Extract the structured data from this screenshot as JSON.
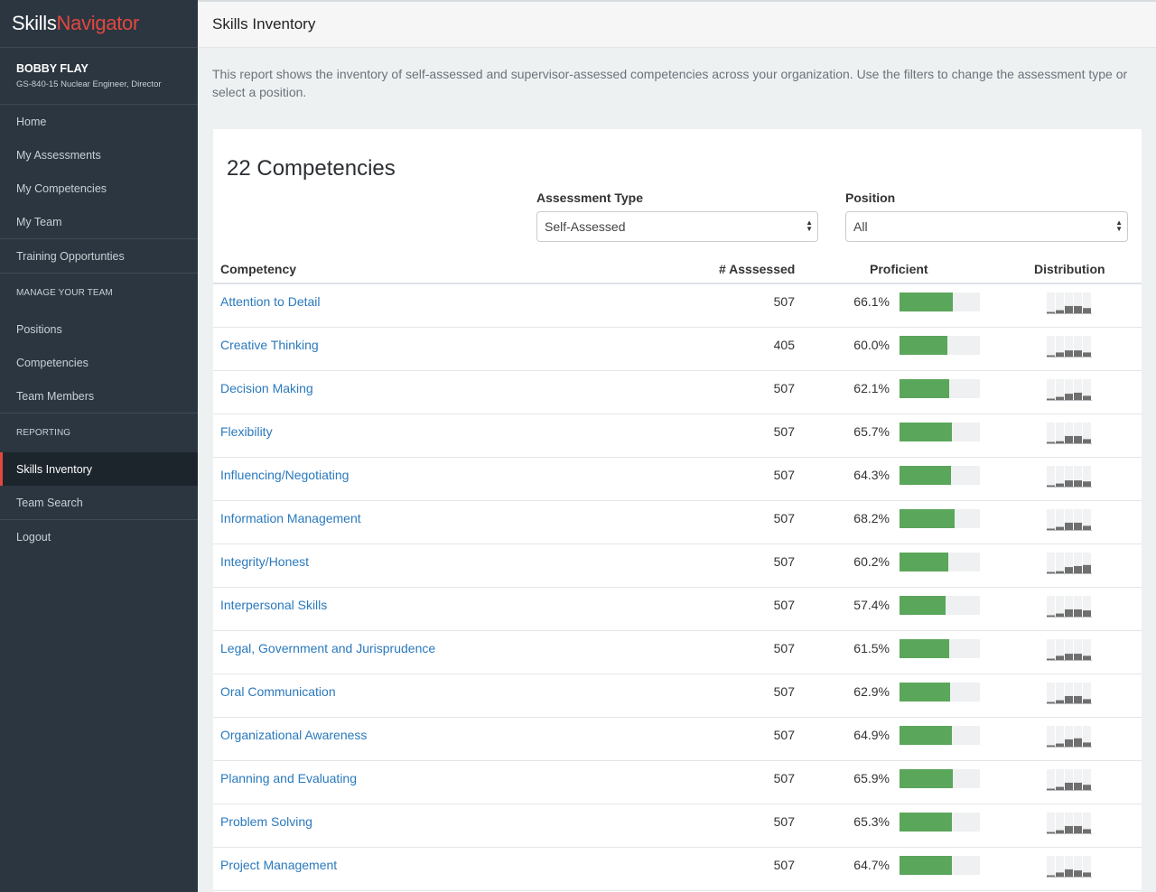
{
  "brand": {
    "part1": "Skills",
    "part2": "Navigator"
  },
  "user": {
    "name": "BOBBY FLAY",
    "title": "GS-840-15 Nuclear Engineer, Director"
  },
  "nav": {
    "home": "Home",
    "my_assessments": "My Assessments",
    "my_competencies": "My Competencies",
    "my_team": "My Team",
    "training": "Training Opportunties",
    "manage_header": "MANAGE YOUR TEAM",
    "positions": "Positions",
    "competencies": "Competencies",
    "team_members": "Team Members",
    "reporting_header": "REPORTING",
    "skills_inventory": "Skills Inventory",
    "team_search": "Team Search",
    "logout": "Logout"
  },
  "page": {
    "title": "Skills Inventory",
    "description": "This report shows the inventory of self-assessed and supervisor-assessed competencies across your organization. Use the filters to change the assessment type or select a position."
  },
  "panel": {
    "count_label": "22 Competencies",
    "assessment_type_label": "Assessment Type",
    "assessment_type_value": "Self-Assessed",
    "position_label": "Position",
    "position_value": "All"
  },
  "table": {
    "headers": {
      "competency": "Competency",
      "assessed": "# Asssessed",
      "proficient": "Proficient",
      "distribution": "Distribution"
    },
    "rows": [
      {
        "name": "Attention to Detail",
        "assessed": "507",
        "proficient": "66.1%",
        "proficient_value": 66.1,
        "dist": [
          0.05,
          0.15,
          0.35,
          0.35,
          0.25
        ]
      },
      {
        "name": "Creative Thinking",
        "assessed": "405",
        "proficient": "60.0%",
        "proficient_value": 60.0,
        "dist": [
          0.05,
          0.2,
          0.3,
          0.3,
          0.2
        ]
      },
      {
        "name": "Decision Making",
        "assessed": "507",
        "proficient": "62.1%",
        "proficient_value": 62.1,
        "dist": [
          0.05,
          0.15,
          0.3,
          0.35,
          0.2
        ]
      },
      {
        "name": "Flexibility",
        "assessed": "507",
        "proficient": "65.7%",
        "proficient_value": 65.7,
        "dist": [
          0.05,
          0.1,
          0.35,
          0.35,
          0.2
        ]
      },
      {
        "name": "Influencing/Negotiating",
        "assessed": "507",
        "proficient": "64.3%",
        "proficient_value": 64.3,
        "dist": [
          0.05,
          0.15,
          0.3,
          0.3,
          0.25
        ]
      },
      {
        "name": "Information Management",
        "assessed": "507",
        "proficient": "68.2%",
        "proficient_value": 68.2,
        "dist": [
          0.05,
          0.15,
          0.35,
          0.35,
          0.2
        ]
      },
      {
        "name": "Integrity/Honest",
        "assessed": "507",
        "proficient": "60.2%",
        "proficient_value": 60.2,
        "dist": [
          0.05,
          0.1,
          0.3,
          0.35,
          0.4
        ]
      },
      {
        "name": "Interpersonal Skills",
        "assessed": "507",
        "proficient": "57.4%",
        "proficient_value": 57.4,
        "dist": [
          0.05,
          0.15,
          0.35,
          0.35,
          0.3
        ]
      },
      {
        "name": "Legal, Government and Jurisprudence",
        "assessed": "507",
        "proficient": "61.5%",
        "proficient_value": 61.5,
        "dist": [
          0.05,
          0.2,
          0.3,
          0.3,
          0.2
        ]
      },
      {
        "name": "Oral Communication",
        "assessed": "507",
        "proficient": "62.9%",
        "proficient_value": 62.9,
        "dist": [
          0.05,
          0.15,
          0.35,
          0.35,
          0.2
        ]
      },
      {
        "name": "Organizational Awareness",
        "assessed": "507",
        "proficient": "64.9%",
        "proficient_value": 64.9,
        "dist": [
          0.05,
          0.15,
          0.35,
          0.4,
          0.2
        ]
      },
      {
        "name": "Planning and Evaluating",
        "assessed": "507",
        "proficient": "65.9%",
        "proficient_value": 65.9,
        "dist": [
          0.05,
          0.15,
          0.35,
          0.35,
          0.25
        ]
      },
      {
        "name": "Problem Solving",
        "assessed": "507",
        "proficient": "65.3%",
        "proficient_value": 65.3,
        "dist": [
          0.05,
          0.15,
          0.35,
          0.35,
          0.2
        ]
      },
      {
        "name": "Project Management",
        "assessed": "507",
        "proficient": "64.7%",
        "proficient_value": 64.7,
        "dist": [
          0.05,
          0.2,
          0.35,
          0.3,
          0.2
        ]
      }
    ]
  },
  "colors": {
    "brand_red": "#e4473f",
    "link_blue": "#2a79bd",
    "bar_green": "#5aa65a",
    "sidebar": "#2b3640"
  }
}
